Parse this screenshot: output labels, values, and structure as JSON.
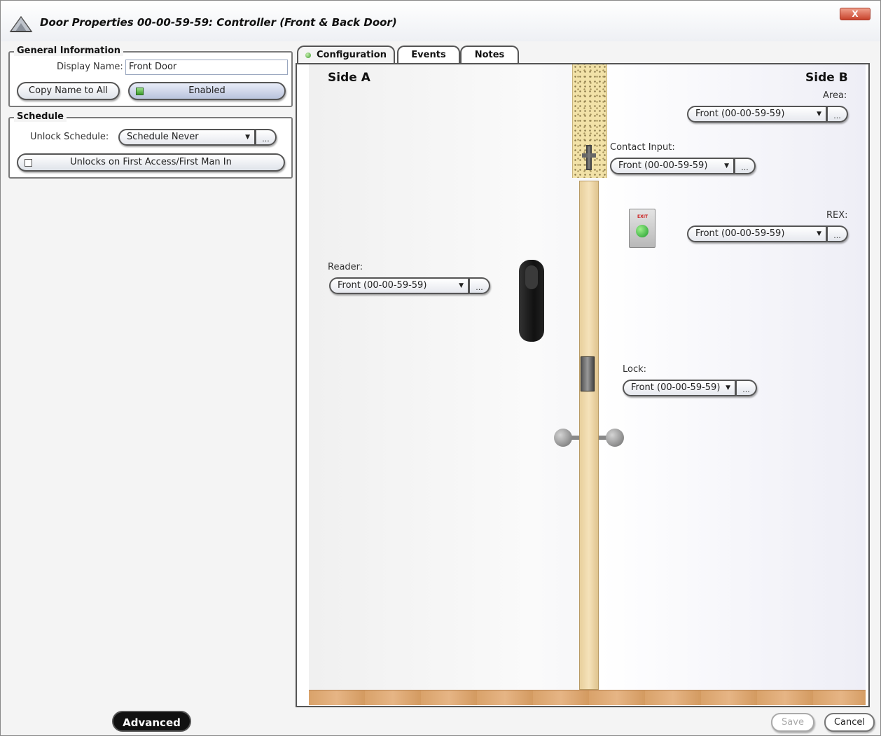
{
  "window": {
    "title": "Door Properties  00-00-59-59: Controller (Front & Back Door)",
    "close_label": "X"
  },
  "general_information": {
    "legend": "General Information",
    "display_name_label": "Display Name:",
    "display_name_value": "Front Door",
    "copy_name_button": "Copy Name to All",
    "enabled_label": "Enabled",
    "enabled_checked": true
  },
  "schedule": {
    "legend": "Schedule",
    "unlock_schedule_label": "Unlock Schedule:",
    "unlock_schedule_value": "Schedule Never",
    "ellipsis": "...",
    "first_access_label": "Unlocks on First Access/First Man In",
    "first_access_checked": false
  },
  "tabs": [
    {
      "label": "Configuration",
      "active": true
    },
    {
      "label": "Events",
      "active": false
    },
    {
      "label": "Notes",
      "active": false
    }
  ],
  "configuration": {
    "side_a_title": "Side A",
    "side_b_title": "Side B",
    "area": {
      "label": "Area:",
      "value": "Front (00-00-59-59)"
    },
    "contact_input": {
      "label": "Contact Input:",
      "value": "Front (00-00-59-59)"
    },
    "rex": {
      "label": "REX:",
      "value": "Front (00-00-59-59)"
    },
    "reader": {
      "label": "Reader:",
      "value": "Front (00-00-59-59)"
    },
    "lock": {
      "label": "Lock:",
      "value": "Front (00-00-59-59)"
    },
    "ellipsis": "...",
    "rex_plate_text": "EXIT"
  },
  "footer": {
    "advanced_button": "Advanced",
    "save_button": "Save",
    "cancel_button": "Cancel",
    "save_enabled": false
  }
}
